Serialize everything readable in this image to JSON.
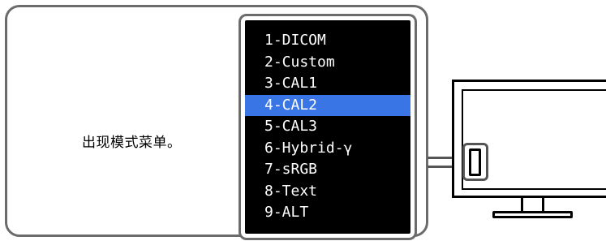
{
  "caption": "出现模式菜单。",
  "menu": {
    "items": [
      {
        "label": "1-DICOM",
        "selected": false
      },
      {
        "label": "2-Custom",
        "selected": false
      },
      {
        "label": "3-CAL1",
        "selected": false
      },
      {
        "label": "4-CAL2",
        "selected": true
      },
      {
        "label": "5-CAL3",
        "selected": false
      },
      {
        "label": "6-Hybrid-γ",
        "selected": false
      },
      {
        "label": "7-sRGB",
        "selected": false
      },
      {
        "label": "8-Text",
        "selected": false
      },
      {
        "label": "9-ALT",
        "selected": false
      }
    ]
  },
  "colors": {
    "menu_background": "#000000",
    "menu_text": "#ffffff",
    "selected_background": "#3a75e6",
    "frame_border": "#6b6b6b"
  }
}
